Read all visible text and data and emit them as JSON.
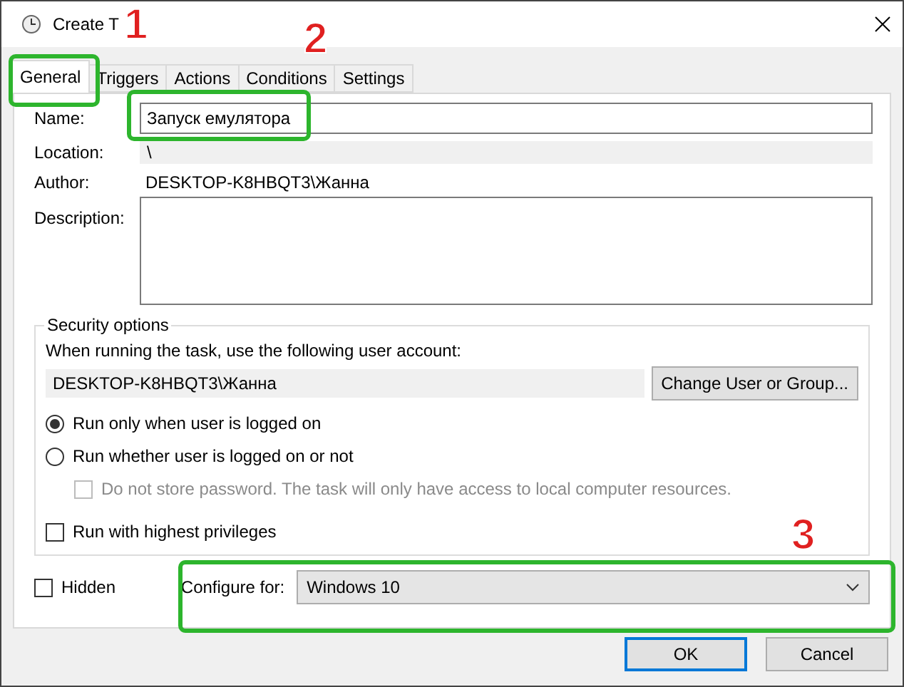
{
  "window": {
    "title": "Create T"
  },
  "tabs": [
    {
      "label": "General",
      "selected": true
    },
    {
      "label": "Triggers",
      "selected": false
    },
    {
      "label": "Actions",
      "selected": false
    },
    {
      "label": "Conditions",
      "selected": false
    },
    {
      "label": "Settings",
      "selected": false
    }
  ],
  "general": {
    "name_label": "Name:",
    "name_value": "Запуск емулятора",
    "location_label": "Location:",
    "location_value": "\\",
    "author_label": "Author:",
    "author_value": "DESKTOP-K8HBQT3\\Жанна",
    "description_label": "Description:"
  },
  "security": {
    "title": "Security options",
    "account_prompt": "When running the task, use the following user account:",
    "account": "DESKTOP-K8HBQT3\\Жанна",
    "change_button": "Change User or Group...",
    "options": [
      {
        "kind": "radio",
        "label": "Run only when user is logged on",
        "selected": true,
        "disabled": false,
        "indented": false
      },
      {
        "kind": "radio",
        "label": "Run whether user is logged on or not",
        "selected": false,
        "disabled": false,
        "indented": false
      },
      {
        "kind": "checkbox",
        "label": "Do not store password.  The task will only have access to local computer resources.",
        "checked": false,
        "disabled": true,
        "indented": true
      },
      {
        "kind": "checkbox",
        "label": "Run with highest privileges",
        "checked": false,
        "disabled": false,
        "indented": false
      }
    ]
  },
  "hidden": {
    "label": "Hidden",
    "checked": false
  },
  "configure": {
    "label": "Configure for:",
    "value": "Windows 10"
  },
  "buttons": [
    {
      "label": "OK",
      "default": true
    },
    {
      "label": "Cancel",
      "default": false
    }
  ],
  "annotations": [
    {
      "number": "1"
    },
    {
      "number": "2"
    },
    {
      "number": "3"
    }
  ]
}
